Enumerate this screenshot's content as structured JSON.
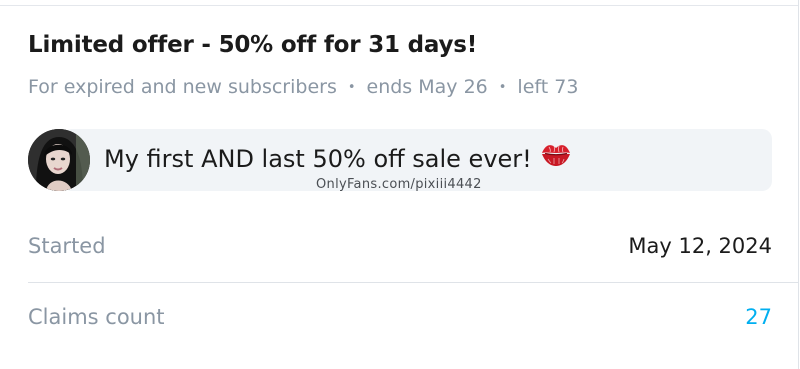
{
  "offer": {
    "title": "Limited offer - 50% off for 31 days!",
    "audience": "For expired and new subscribers",
    "ends": "ends May 26",
    "left": "left 73",
    "separator": "•"
  },
  "message": {
    "text": "My first AND last 50% off sale ever!",
    "emoji_icon": "kiss-mark-icon",
    "avatar_icon": "creator-avatar"
  },
  "watermark": "OnlyFans.com/pixiii4442",
  "details": {
    "started_label": "Started",
    "started_value": "May 12, 2024",
    "claims_label": "Claims count",
    "claims_value": "27"
  },
  "colors": {
    "accent": "#00aff0",
    "muted_text": "#8a96a3",
    "bubble_bg": "#f1f4f7",
    "divider": "#dfe3e8"
  }
}
